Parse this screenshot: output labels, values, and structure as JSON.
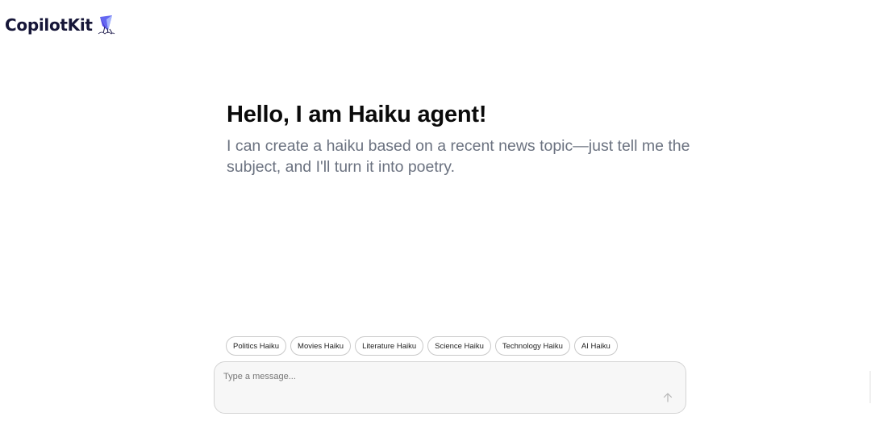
{
  "brand": {
    "name": "CopilotKit",
    "logo_icon": "kite-logo-icon"
  },
  "welcome": {
    "title": "Hello, I am Haiku agent!",
    "subtitle": "I can create a haiku based on a recent news topic—just tell me the subject, and I'll turn it into poetry."
  },
  "suggestions": [
    {
      "label": "Politics Haiku"
    },
    {
      "label": "Movies Haiku"
    },
    {
      "label": "Literature Haiku"
    },
    {
      "label": "Science Haiku"
    },
    {
      "label": "Technology Haiku"
    },
    {
      "label": "AI Haiku"
    }
  ],
  "composer": {
    "placeholder": "Type a message...",
    "value": "",
    "send_icon": "arrow-up-icon"
  },
  "colors": {
    "brand_text": "#161638",
    "subtitle_text": "#6b7280",
    "logo_accent": "#6366f1"
  }
}
